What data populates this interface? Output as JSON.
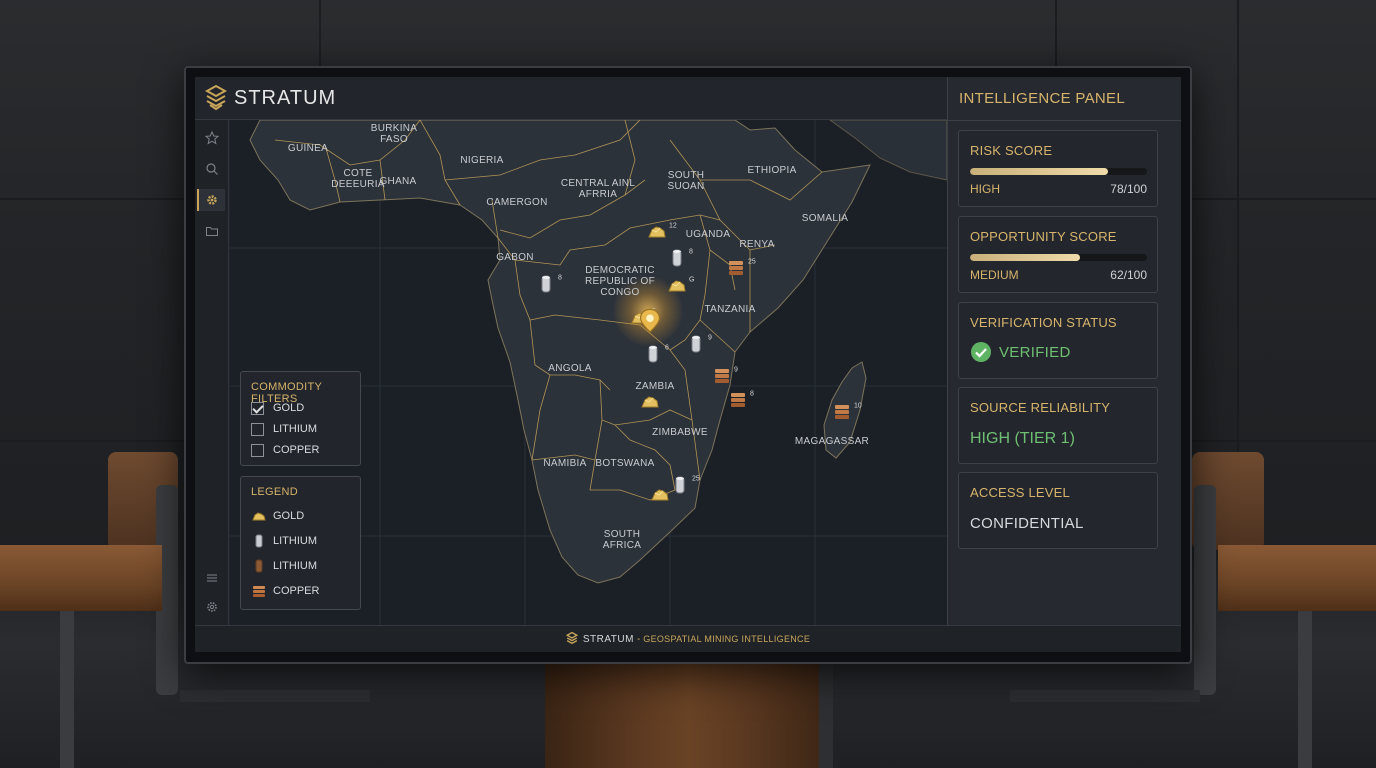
{
  "app": {
    "brand": "STRATUM",
    "footer_brand": "STRATUM",
    "footer_separator": "-",
    "footer_tagline": "GEOSPATIAL MINING INTELLIGENCE",
    "accent_color": "#d7b46c"
  },
  "sidebar": {
    "items": [
      {
        "icon": "star-icon"
      },
      {
        "icon": "search-icon"
      },
      {
        "icon": "gear-icon",
        "active": true
      },
      {
        "icon": "folder-icon"
      }
    ],
    "bottom_items": [
      {
        "icon": "menu-icon"
      },
      {
        "icon": "settings-icon"
      }
    ]
  },
  "map": {
    "countries": {
      "guinea": "GUINEA",
      "burkina_faso": "BURKINA\nFASO",
      "cote": "COTE\nDEEEURIA",
      "ghana": "GHANA",
      "nigeria": "NIGERIA",
      "central_african": "CENTRAL AINL\nAFRRIA",
      "south_sudan": "SOUTH\nSUOAN",
      "ethiopia": "ETHIOPIA",
      "cameroon": "CAMERGON",
      "somalia": "SOMALIA",
      "uganda": "UGANDA",
      "kenya": "RENYA",
      "gabon": "GABON",
      "drc": "DEMOCRATIC\nREPUBLIC OF\nCONGO",
      "tanzania": "TANZANIA",
      "angola": "ANGOLA",
      "zambia": "ZAMBIA",
      "zimbabwe": "ZIMBABWE",
      "madagascar": "MAGAGASSAR",
      "namibia": "NAMIBIA",
      "botswana": "BOTSWANA",
      "south_africa": "SOUTH\nAFRICA"
    },
    "markers": [
      {
        "type": "gold",
        "count": "12"
      },
      {
        "type": "lithium",
        "count": "8"
      },
      {
        "type": "lithium",
        "count": "8"
      },
      {
        "type": "gold",
        "count": "G"
      },
      {
        "type": "copper",
        "count": "25"
      },
      {
        "type": "gold",
        "count": "5"
      },
      {
        "type": "lithium",
        "count": "9"
      },
      {
        "type": "lithium",
        "count": "6"
      },
      {
        "type": "copper",
        "count": "9"
      },
      {
        "type": "copper",
        "count": "8"
      },
      {
        "type": "gold",
        "count": ""
      },
      {
        "type": "copper",
        "count": "10"
      },
      {
        "type": "gold",
        "count": ""
      },
      {
        "type": "lithium",
        "count": "25"
      }
    ]
  },
  "filters": {
    "title": "COMMODITY FILTERS",
    "items": [
      {
        "label": "GOLD",
        "checked": true
      },
      {
        "label": "LITHIUM",
        "checked": false
      },
      {
        "label": "COPPER",
        "checked": false
      }
    ]
  },
  "legend": {
    "title": "LEGEND",
    "items": [
      {
        "label": "GOLD",
        "icon": "gold-nugget-icon"
      },
      {
        "label": "LITHIUM",
        "icon": "lithium-cylinder-icon"
      },
      {
        "label": "LITHIUM",
        "icon": "lithium-cylinder-brown-icon"
      },
      {
        "label": "COPPER",
        "icon": "copper-stack-icon"
      }
    ]
  },
  "intel": {
    "title": "INTELLIGENCE PANEL",
    "risk": {
      "title": "RISK SCORE",
      "level": "HIGH",
      "score": "78/100",
      "value": 0.78
    },
    "opportunity": {
      "title": "OPPORTUNITY SCORE",
      "level": "MEDIUM",
      "score": "62/100",
      "value": 0.62
    },
    "verification": {
      "title": "VERIFICATION STATUS",
      "value": "VERIFIED",
      "color": "#6fbf73"
    },
    "reliability": {
      "title": "SOURCE RELIABILITY",
      "value": "HIGH (TIER 1)",
      "color": "#6fbf73"
    },
    "access": {
      "title": "ACCESS LEVEL",
      "value": "CONFIDENTIAL"
    }
  }
}
